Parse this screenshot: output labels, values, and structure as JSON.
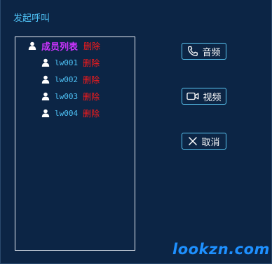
{
  "dialog": {
    "title": "发起呼叫"
  },
  "member_list": {
    "group": {
      "label": "成员列表",
      "delete_label": "删除",
      "icon": "user-icon"
    },
    "members": [
      {
        "label": "lw001",
        "delete_label": "删除",
        "icon": "user-icon"
      },
      {
        "label": "lw002",
        "delete_label": "删除",
        "icon": "user-icon"
      },
      {
        "label": "lw003",
        "delete_label": "删除",
        "icon": "user-icon"
      },
      {
        "label": "lw004",
        "delete_label": "删除",
        "icon": "user-icon"
      }
    ]
  },
  "actions": {
    "audio_label": "音频",
    "audio_icon": "phone-icon",
    "video_label": "视频",
    "video_icon": "video-camera-icon",
    "cancel_label": "取消",
    "cancel_icon": "close-icon"
  },
  "watermark": {
    "text": "lookzn.com"
  },
  "colors": {
    "background": "#0c2545",
    "accent": "#4fc3f7",
    "group_label": "#cc33ff",
    "delete": "#ff1a1a",
    "border": "#e8eef5",
    "button_border": "#5bc8f5",
    "watermark": "#1e90ff"
  }
}
